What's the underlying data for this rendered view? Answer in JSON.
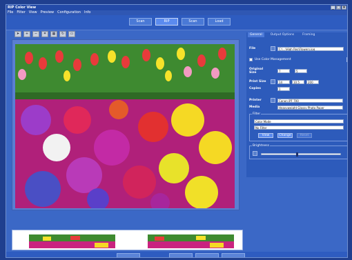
{
  "window": {
    "title": "RIP Color View",
    "controls": [
      "_",
      "□",
      "x"
    ]
  },
  "menu": [
    "File",
    "Filter",
    "View",
    "Preview",
    "Configuration",
    "Info"
  ],
  "modes": [
    {
      "label": "Scan",
      "active": false
    },
    {
      "label": "RIP",
      "active": true
    },
    {
      "label": "Scan",
      "active": false
    },
    {
      "label": "Load",
      "active": false
    }
  ],
  "toolbar_icons": [
    "pointer-icon",
    "zoom-in-icon",
    "zoom-out-icon",
    "crop-icon",
    "grid-icon",
    "rotate-icon",
    "fit-icon"
  ],
  "panel": {
    "tabs": [
      {
        "label": "General",
        "active": true
      },
      {
        "label": "Output Options",
        "active": false
      },
      {
        "label": "Framing",
        "active": false
      }
    ],
    "file_label": "File",
    "file_value": "C:\\...\\High Res\\Flowers.jpg",
    "color_mgmt_label": "Use Color Management",
    "original_size_label": "Original Size",
    "original_w": "7",
    "original_h": "5",
    "print_size_label": "Print Size",
    "print_w": "14",
    "print_h": "10.5",
    "print_dpi": "200",
    "copies_label": "Copies",
    "copies": "1",
    "printer_label": "Printer",
    "printer_value": "Canon iPF 700",
    "media_label": "Media",
    "media_value": "Heavyweight Glossy Photo Paper",
    "filter_title": "Filter",
    "filter_select1": "Color Mode",
    "filter_select2": "No Filter",
    "filter_buttons": [
      "View",
      "Change",
      "Reset"
    ],
    "brightness_label": "Brightness",
    "brightness_level": 0.45
  }
}
